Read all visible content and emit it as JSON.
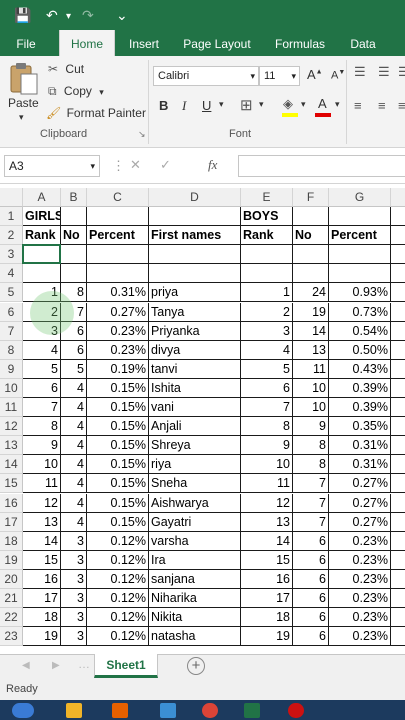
{
  "app": {
    "name": "Excel"
  },
  "qat": {
    "save": "💾",
    "undo": "↶",
    "redo": "↷",
    "more": "⌄"
  },
  "tabs": [
    {
      "label": "File"
    },
    {
      "label": "Home"
    },
    {
      "label": "Insert"
    },
    {
      "label": "Page Layout"
    },
    {
      "label": "Formulas"
    },
    {
      "label": "Data"
    }
  ],
  "ribbon": {
    "clipboard": {
      "paste": "Paste",
      "cut": "Cut",
      "copy": "Copy",
      "format_painter": "Format Painter",
      "group": "Clipboard"
    },
    "font": {
      "name": "Calibri",
      "size": "11",
      "bold": "B",
      "italic": "I",
      "underline": "U",
      "grow": "A",
      "shrink": "A",
      "group": "Font"
    }
  },
  "formula_bar": {
    "name_box": "A3",
    "fx": "fx",
    "formula": ""
  },
  "columns": [
    "A",
    "B",
    "C",
    "D",
    "E",
    "F",
    "G"
  ],
  "rows": [
    {
      "n": "1",
      "a": "GIRLS",
      "b": "",
      "c": "",
      "d": "",
      "e": "BOYS",
      "f": "",
      "g": ""
    },
    {
      "n": "2",
      "a": "Rank",
      "b": "No",
      "c": "Percent",
      "d": "First names",
      "e": "Rank",
      "f": "No",
      "g": "Percent"
    },
    {
      "n": "3",
      "a": "",
      "b": "",
      "c": "",
      "d": "",
      "e": "",
      "f": "",
      "g": ""
    },
    {
      "n": "4",
      "a": "",
      "b": "",
      "c": "",
      "d": "",
      "e": "",
      "f": "",
      "g": ""
    },
    {
      "n": "5",
      "a": "1",
      "b": "8",
      "c": "0.31%",
      "d": "priya",
      "e": "1",
      "f": "24",
      "g": "0.93%"
    },
    {
      "n": "6",
      "a": "2",
      "b": "7",
      "c": "0.27%",
      "d": "Tanya",
      "e": "2",
      "f": "19",
      "g": "0.73%"
    },
    {
      "n": "7",
      "a": "3",
      "b": "6",
      "c": "0.23%",
      "d": "Priyanka",
      "e": "3",
      "f": "14",
      "g": "0.54%"
    },
    {
      "n": "8",
      "a": "4",
      "b": "6",
      "c": "0.23%",
      "d": "divya",
      "e": "4",
      "f": "13",
      "g": "0.50%"
    },
    {
      "n": "9",
      "a": "5",
      "b": "5",
      "c": "0.19%",
      "d": "tanvi",
      "e": "5",
      "f": "11",
      "g": "0.43%"
    },
    {
      "n": "10",
      "a": "6",
      "b": "4",
      "c": "0.15%",
      "d": "Ishita",
      "e": "6",
      "f": "10",
      "g": "0.39%"
    },
    {
      "n": "11",
      "a": "7",
      "b": "4",
      "c": "0.15%",
      "d": "vani",
      "e": "7",
      "f": "10",
      "g": "0.39%"
    },
    {
      "n": "12",
      "a": "8",
      "b": "4",
      "c": "0.15%",
      "d": "Anjali",
      "e": "8",
      "f": "9",
      "g": "0.35%"
    },
    {
      "n": "13",
      "a": "9",
      "b": "4",
      "c": "0.15%",
      "d": "Shreya",
      "e": "9",
      "f": "8",
      "g": "0.31%"
    },
    {
      "n": "14",
      "a": "10",
      "b": "4",
      "c": "0.15%",
      "d": "riya",
      "e": "10",
      "f": "8",
      "g": "0.31%"
    },
    {
      "n": "15",
      "a": "11",
      "b": "4",
      "c": "0.15%",
      "d": "Sneha",
      "e": "11",
      "f": "7",
      "g": "0.27%"
    },
    {
      "n": "16",
      "a": "12",
      "b": "4",
      "c": "0.15%",
      "d": "Aishwarya",
      "e": "12",
      "f": "7",
      "g": "0.27%"
    },
    {
      "n": "17",
      "a": "13",
      "b": "4",
      "c": "0.15%",
      "d": "Gayatri",
      "e": "13",
      "f": "7",
      "g": "0.27%"
    },
    {
      "n": "18",
      "a": "14",
      "b": "3",
      "c": "0.12%",
      "d": "varsha",
      "e": "14",
      "f": "6",
      "g": "0.23%"
    },
    {
      "n": "19",
      "a": "15",
      "b": "3",
      "c": "0.12%",
      "d": "Ira",
      "e": "15",
      "f": "6",
      "g": "0.23%"
    },
    {
      "n": "20",
      "a": "16",
      "b": "3",
      "c": "0.12%",
      "d": "sanjana",
      "e": "16",
      "f": "6",
      "g": "0.23%"
    },
    {
      "n": "21",
      "a": "17",
      "b": "3",
      "c": "0.12%",
      "d": "Niharika",
      "e": "17",
      "f": "6",
      "g": "0.23%"
    },
    {
      "n": "22",
      "a": "18",
      "b": "3",
      "c": "0.12%",
      "d": "Nikita",
      "e": "18",
      "f": "6",
      "g": "0.23%"
    },
    {
      "n": "23",
      "a": "19",
      "b": "3",
      "c": "0.12%",
      "d": "natasha",
      "e": "19",
      "f": "6",
      "g": "0.23%"
    }
  ],
  "sheet_tab": {
    "label": "Sheet1"
  },
  "status": {
    "text": "Ready"
  },
  "colors": {
    "excel_green": "#217346",
    "taskbar": "#1c3a5e"
  }
}
